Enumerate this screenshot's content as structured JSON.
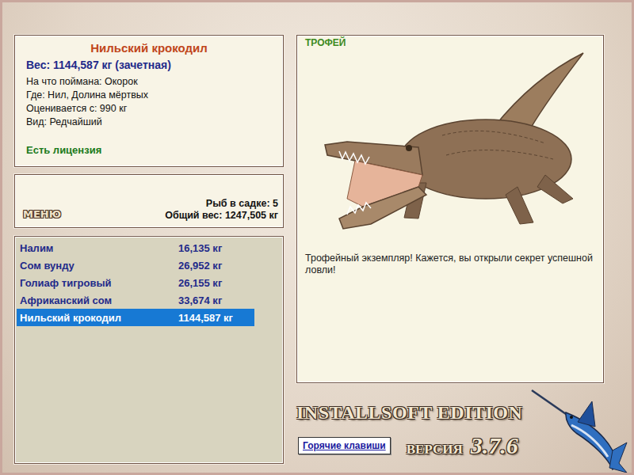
{
  "fish_card": {
    "title": "Нильский крокодил",
    "weight": "Вес: 1144,587 кг (зачетная)",
    "details": [
      "На что поймана: Окорок",
      "Где: Нил, Долина мёртвых",
      "Оценивается с: 990 кг",
      "Вид: Редчайший"
    ],
    "license": "Есть лицензия"
  },
  "menu_button": "МЕНЮ",
  "keepnet": {
    "count": "Рыб в садке: 5",
    "total": "Общий вес: 1247,505 кг"
  },
  "catch_list": [
    {
      "name": "Налим",
      "weight": "16,135 кг",
      "selected": false
    },
    {
      "name": "Сом вунду",
      "weight": "26,952 кг",
      "selected": false
    },
    {
      "name": "Голиаф тигровый",
      "weight": "26,155 кг",
      "selected": false
    },
    {
      "name": "Африканский сом",
      "weight": "33,674 кг",
      "selected": false
    },
    {
      "name": "Нильский крокодил",
      "weight": "1144,587 кг",
      "selected": true
    }
  ],
  "trophy": {
    "badge": "ТРОФЕЙ",
    "message": "Трофейный экземпляр! Кажется, вы открыли секрет успешной ловли!"
  },
  "logo": {
    "text": "INSTALLSOFT EDITION",
    "version_label": "ВЕРСИЯ",
    "version": "3.7.6"
  },
  "hotkeys_button": "Горячие клавиши"
}
